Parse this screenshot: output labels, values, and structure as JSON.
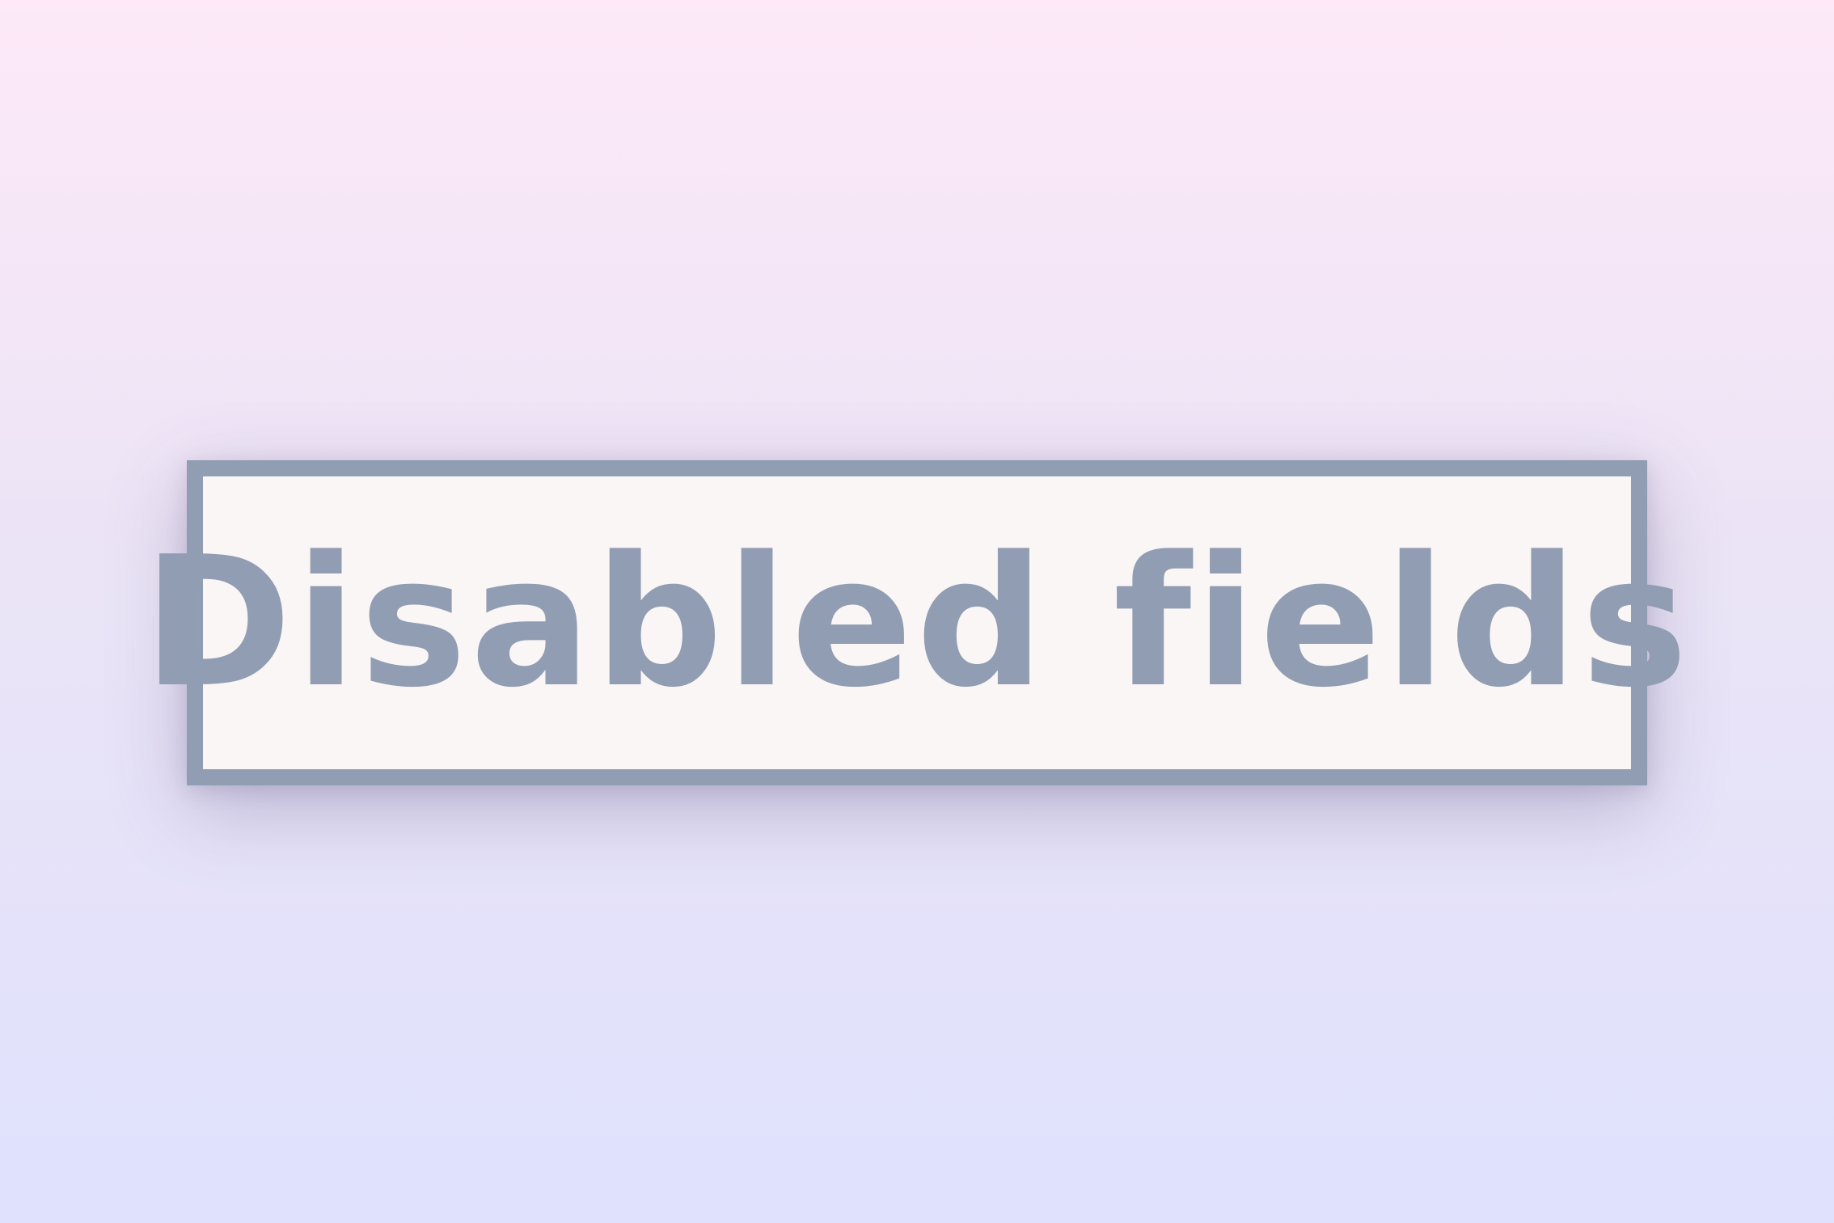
{
  "field": {
    "label": "Disabled fields",
    "state": "disabled"
  },
  "colors": {
    "background_top": "#fde9f8",
    "background_bottom": "#dfe1fd",
    "field_fill": "#faf6f6",
    "field_border": "#919db2",
    "field_text": "#919db2"
  }
}
